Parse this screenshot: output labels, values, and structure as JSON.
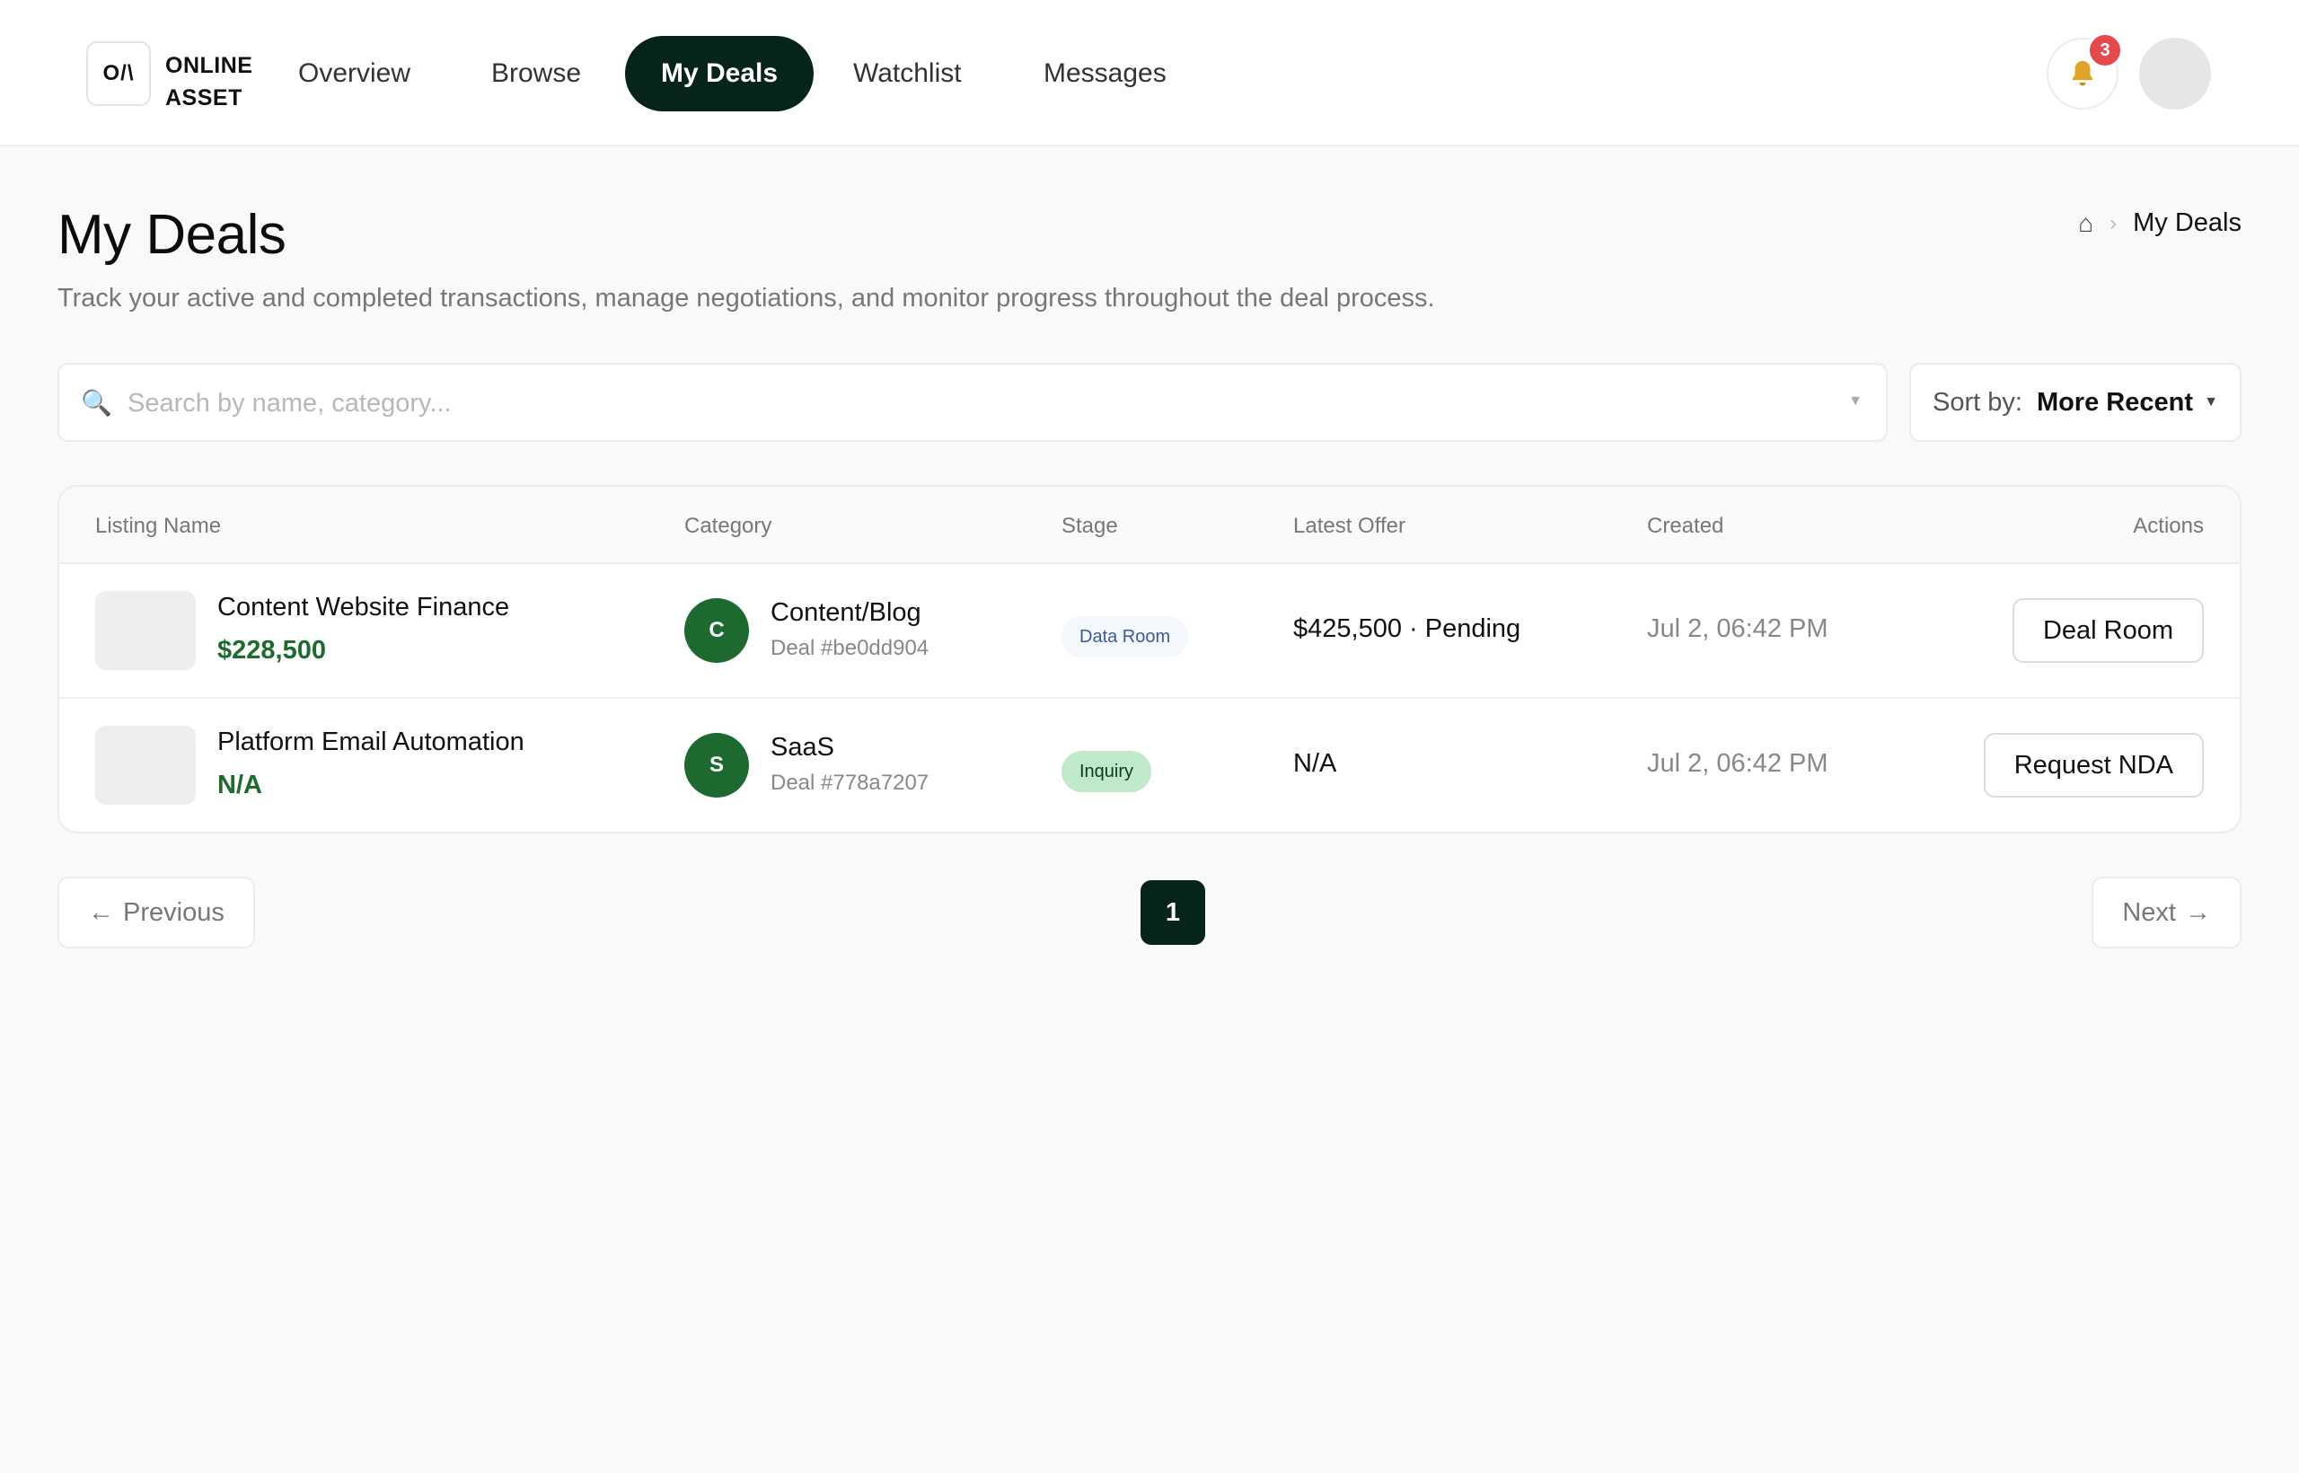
{
  "brand": {
    "logo_mark": "O/\\",
    "name_line1": "ONLINE",
    "name_line2": "ASSET"
  },
  "nav": {
    "items": [
      {
        "label": "Overview",
        "active": false
      },
      {
        "label": "Browse",
        "active": false
      },
      {
        "label": "My Deals",
        "active": true
      },
      {
        "label": "Watchlist",
        "active": false
      },
      {
        "label": "Messages",
        "active": false
      }
    ]
  },
  "header": {
    "notification_icon": "bell-icon",
    "notification_count": "3"
  },
  "page": {
    "title": "My Deals",
    "subtitle": "Track your active and completed transactions, manage negotiations, and monitor progress throughout the deal process."
  },
  "breadcrumb": {
    "home_icon": "⌂",
    "separator": "›",
    "current": "My Deals"
  },
  "search": {
    "placeholder": "Search by name, category...",
    "value": ""
  },
  "sort": {
    "label": "Sort by:",
    "value": "More Recent"
  },
  "table": {
    "columns": [
      "Listing Name",
      "Category",
      "Stage",
      "Latest Offer",
      "Created",
      "Actions"
    ],
    "rows": [
      {
        "name": "Content Website Finance",
        "price": "$228,500",
        "category_initial": "C",
        "category": "Content/Blog",
        "deal_id": "Deal #be0dd904",
        "stage": "Data Room",
        "latest_offer": "$425,500 · Pending",
        "created": "Jul 2, 06:42 PM",
        "action": "Deal Room"
      },
      {
        "name": "Platform Email Automation",
        "price": "N/A",
        "category_initial": "S",
        "category": "SaaS",
        "deal_id": "Deal #778a7207",
        "stage": "Inquiry",
        "latest_offer": "N/A",
        "created": "Jul 2, 06:42 PM",
        "action": "Request NDA"
      }
    ]
  },
  "pagination": {
    "previous": "Previous",
    "next": "Next",
    "current_page": "1",
    "prev_arrow": "←",
    "next_arrow": "→"
  },
  "colors": {
    "brand_dark": "#062417",
    "price_green": "#1e6b2e",
    "badge_red": "#e5484d",
    "stage_inquiry_bg": "#bfe9c8"
  }
}
